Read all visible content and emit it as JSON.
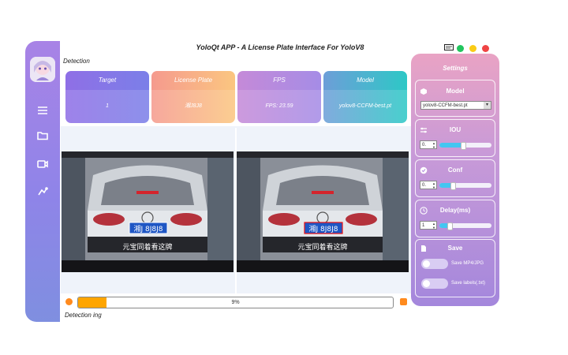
{
  "window": {
    "title": "YoloQt APP - A License Plate Interface For YoloV8"
  },
  "sidebar": {
    "items": [
      {
        "icon": "menu-icon"
      },
      {
        "icon": "folder-icon"
      },
      {
        "icon": "camera-icon"
      },
      {
        "icon": "broadcast-icon"
      }
    ]
  },
  "main": {
    "section_label": "Detection",
    "stats": [
      {
        "name": "Target",
        "value": "1",
        "color_from": "#8f6fe6",
        "color_to": "#7b7fe8"
      },
      {
        "name": "License Plate",
        "value": "湘J8J8",
        "color_from": "#f59a8e",
        "color_to": "#fbc680"
      },
      {
        "name": "FPS",
        "value": "FPS: 23.59",
        "color_from": "#c58ad8",
        "color_to": "#a58ce6"
      },
      {
        "name": "Model",
        "value": "yolov8-CCFM-best.pt",
        "color_from": "#6d9ed8",
        "color_to": "#2dc8c6"
      }
    ],
    "video_caption": "元宝同着看这牌",
    "plate_text": "湘J 8J8J8",
    "progress": {
      "value": 0.09,
      "label": "9%"
    },
    "status_text": "Detection ing"
  },
  "settings": {
    "title": "Settings",
    "model": {
      "label": "Model",
      "value": "yolov8-CCFM-best.pt"
    },
    "iou": {
      "label": "IOU",
      "value": "0.",
      "level": 0.45
    },
    "conf": {
      "label": "Conf",
      "value": "0.",
      "level": 0.25
    },
    "delay": {
      "label": "Delay(ms)",
      "value": "1",
      "level": 0.2
    },
    "save": {
      "label": "Save",
      "options": [
        "Save MP4/JPG",
        "Save labels(.txt)"
      ]
    }
  },
  "titlebar": {
    "dots": [
      "#22c55e",
      "#facc15",
      "#ef4444"
    ]
  }
}
